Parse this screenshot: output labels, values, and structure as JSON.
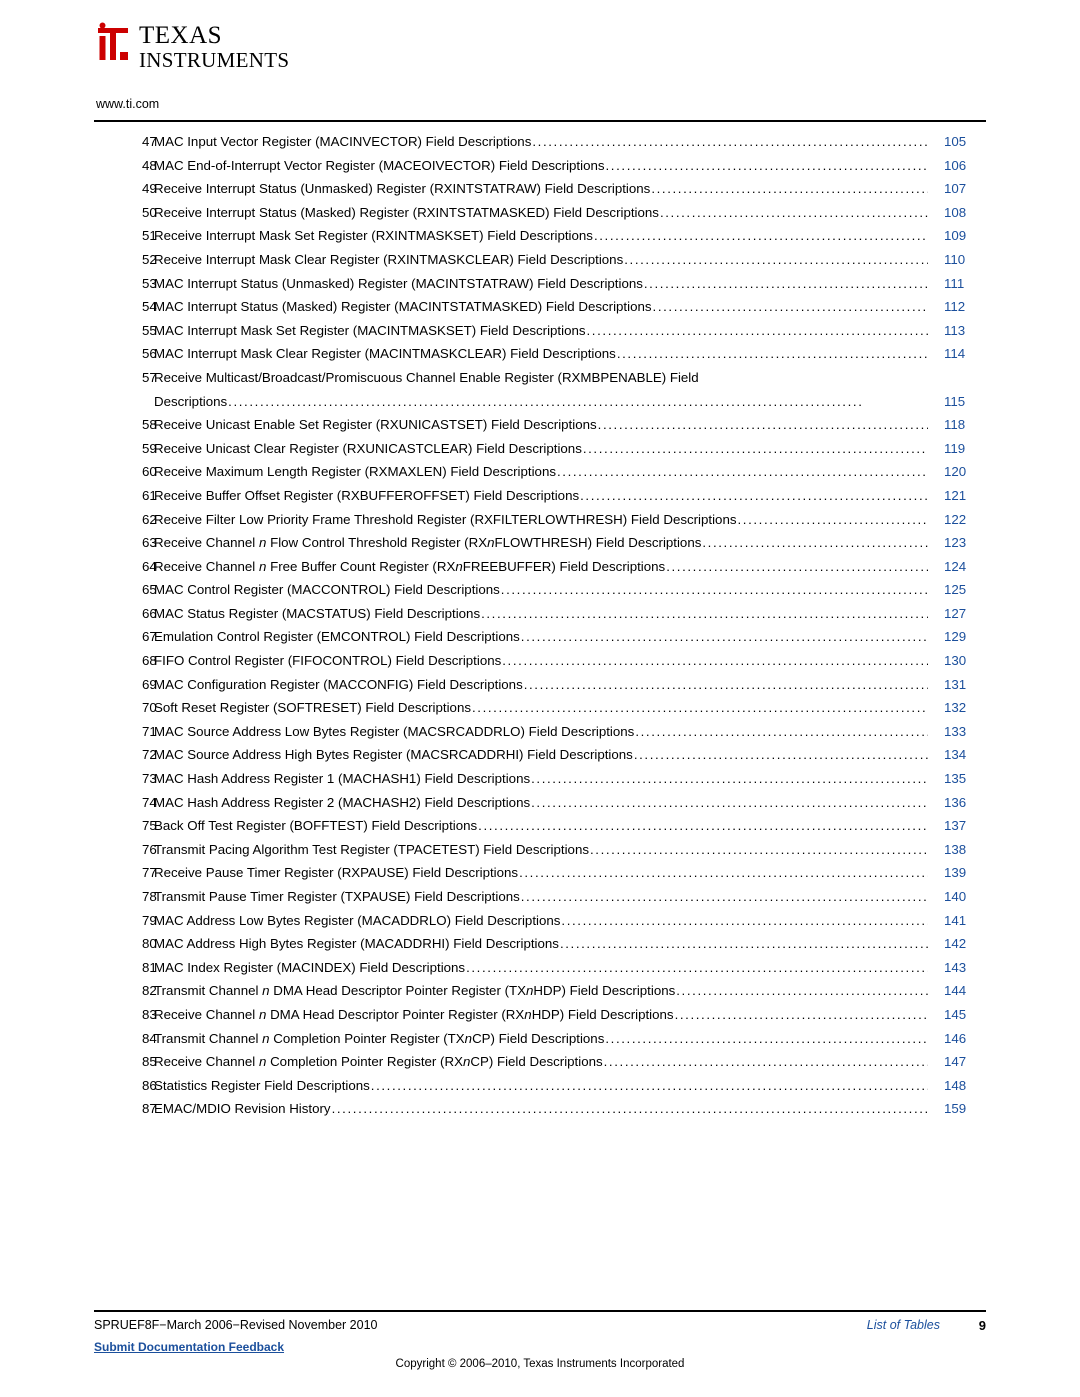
{
  "header": {
    "brand_top": "TEXAS",
    "brand_bottom": "INSTRUMENTS",
    "url": "www.ti.com"
  },
  "toc": {
    "leader_char": "…",
    "entries": [
      {
        "num": "47",
        "title": "MAC Input Vector Register (MACINVECTOR) Field Descriptions",
        "page": "105"
      },
      {
        "num": "48",
        "title": "MAC End-of-Interrupt Vector Register (MACEOIVECTOR) Field Descriptions",
        "page": "106"
      },
      {
        "num": "49",
        "title": "Receive Interrupt Status (Unmasked) Register (RXINTSTATRAW) Field Descriptions",
        "page": "107"
      },
      {
        "num": "50",
        "title": "Receive Interrupt Status (Masked) Register (RXINTSTATMASKED) Field Descriptions",
        "page": "108"
      },
      {
        "num": "51",
        "title": "Receive Interrupt Mask Set Register (RXINTMASKSET) Field Descriptions",
        "page": "109"
      },
      {
        "num": "52",
        "title": "Receive Interrupt Mask Clear Register (RXINTMASKCLEAR) Field Descriptions",
        "page": "110"
      },
      {
        "num": "53",
        "title": "MAC Interrupt Status (Unmasked) Register (MACINTSTATRAW) Field Descriptions",
        "page": "111"
      },
      {
        "num": "54",
        "title": "MAC Interrupt Status (Masked) Register (MACINTSTATMASKED) Field Descriptions",
        "page": "112"
      },
      {
        "num": "55",
        "title": "MAC Interrupt Mask Set Register (MACINTMASKSET) Field Descriptions",
        "page": "113"
      },
      {
        "num": "56",
        "title": "MAC Interrupt Mask Clear Register (MACINTMASKCLEAR) Field Descriptions",
        "page": "114"
      },
      {
        "num": "57",
        "title": "Receive Multicast/Broadcast/Promiscuous Channel Enable Register (RXMBPENABLE) Field",
        "title2": "Descriptions",
        "page": "115"
      },
      {
        "num": "58",
        "title": "Receive Unicast Enable Set Register (RXUNICASTSET) Field Descriptions",
        "page": "118"
      },
      {
        "num": "59",
        "title": "Receive Unicast Clear Register (RXUNICASTCLEAR) Field Descriptions",
        "page": "119"
      },
      {
        "num": "60",
        "title": "Receive Maximum Length Register (RXMAXLEN) Field Descriptions",
        "page": "120"
      },
      {
        "num": "61",
        "title": "Receive Buffer Offset Register (RXBUFFEROFFSET) Field Descriptions",
        "page": "121"
      },
      {
        "num": "62",
        "title": "Receive Filter Low Priority Frame Threshold Register (RXFILTERLOWTHRESH) Field Descriptions",
        "page": "122"
      },
      {
        "num": "63",
        "title_pre": "Receive Channel ",
        "title_ital": "n",
        "title_post": " Flow Control Threshold Register (RX",
        "title_ital2": "n",
        "title_post2": "FLOWTHRESH) Field Descriptions",
        "page": "123"
      },
      {
        "num": "64",
        "title_pre": "Receive Channel ",
        "title_ital": "n",
        "title_post": " Free Buffer Count Register (RX",
        "title_ital2": "n",
        "title_post2": "FREEBUFFER) Field Descriptions",
        "page": "124"
      },
      {
        "num": "65",
        "title": "MAC Control Register (MACCONTROL) Field Descriptions",
        "page": "125"
      },
      {
        "num": "66",
        "title": "MAC Status Register (MACSTATUS) Field Descriptions",
        "page": "127"
      },
      {
        "num": "67",
        "title": "Emulation Control Register (EMCONTROL) Field Descriptions",
        "page": "129"
      },
      {
        "num": "68",
        "title": "FIFO Control Register (FIFOCONTROL) Field Descriptions",
        "page": "130"
      },
      {
        "num": "69",
        "title": "MAC Configuration Register (MACCONFIG) Field Descriptions",
        "page": "131"
      },
      {
        "num": "70",
        "title": "Soft Reset Register (SOFTRESET) Field Descriptions",
        "page": "132"
      },
      {
        "num": "71",
        "title": "MAC Source Address Low Bytes Register (MACSRCADDRLO) Field Descriptions",
        "page": "133"
      },
      {
        "num": "72",
        "title": "MAC Source Address High Bytes Register (MACSRCADDRHI) Field Descriptions",
        "page": "134"
      },
      {
        "num": "73",
        "title": "MAC Hash Address Register 1 (MACHASH1) Field Descriptions",
        "page": "135"
      },
      {
        "num": "74",
        "title": "MAC Hash Address Register 2 (MACHASH2) Field Descriptions",
        "page": "136"
      },
      {
        "num": "75",
        "title": "Back Off Test Register (BOFFTEST) Field Descriptions",
        "page": "137"
      },
      {
        "num": "76",
        "title": "Transmit Pacing Algorithm Test Register (TPACETEST) Field Descriptions",
        "page": "138"
      },
      {
        "num": "77",
        "title": "Receive Pause Timer Register (RXPAUSE) Field Descriptions",
        "page": "139"
      },
      {
        "num": "78",
        "title": "Transmit Pause Timer Register (TXPAUSE) Field Descriptions",
        "page": "140"
      },
      {
        "num": "79",
        "title": "MAC Address Low Bytes Register (MACADDRLO) Field Descriptions",
        "page": "141"
      },
      {
        "num": "80",
        "title": "MAC Address High Bytes Register (MACADDRHI) Field Descriptions",
        "page": "142"
      },
      {
        "num": "81",
        "title": "MAC Index Register (MACINDEX) Field Descriptions",
        "page": "143"
      },
      {
        "num": "82",
        "title_pre": "Transmit Channel ",
        "title_ital": "n",
        "title_post": " DMA Head Descriptor Pointer Register (TX",
        "title_ital2": "n",
        "title_post2": "HDP) Field Descriptions",
        "page": "144"
      },
      {
        "num": "83",
        "title_pre": "Receive Channel ",
        "title_ital": "n",
        "title_post": " DMA Head Descriptor Pointer Register (RX",
        "title_ital2": "n",
        "title_post2": "HDP) Field Descriptions",
        "page": "145"
      },
      {
        "num": "84",
        "title_pre": "Transmit Channel ",
        "title_ital": "n",
        "title_post": " Completion Pointer Register (TX",
        "title_ital2": "n",
        "title_post2": "CP) Field Descriptions",
        "page": "146"
      },
      {
        "num": "85",
        "title_pre": "Receive Channel ",
        "title_ital": "n",
        "title_post": " Completion Pointer Register (RX",
        "title_ital2": "n",
        "title_post2": "CP) Field Descriptions",
        "page": "147"
      },
      {
        "num": "86",
        "title": "Statistics Register Field Descriptions",
        "page": "148"
      },
      {
        "num": "87",
        "title": "EMAC/MDIO Revision History",
        "page": "159"
      }
    ]
  },
  "footer": {
    "doc_id": "SPRUEF8F−March 2006−Revised November 2010",
    "section": "List of Tables",
    "page_number": "9",
    "feedback": "Submit Documentation Feedback",
    "copyright": "Copyright © 2006–2010, Texas Instruments Incorporated"
  }
}
